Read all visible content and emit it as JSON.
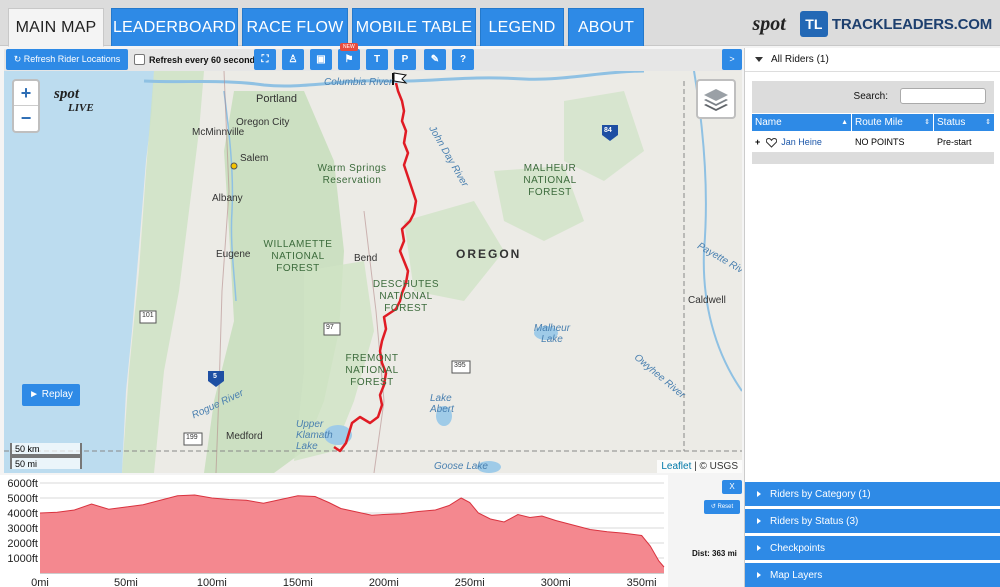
{
  "nav": {
    "tabs": [
      {
        "label": "MAIN MAP",
        "active": true
      },
      {
        "label": "LEADERBOARD",
        "active": false
      },
      {
        "label": "RACE FLOW",
        "active": false
      },
      {
        "label": "MOBILE TABLE",
        "active": false
      },
      {
        "label": "LEGEND",
        "active": false
      },
      {
        "label": "ABOUT",
        "active": false
      }
    ],
    "spot_logo": "spot",
    "tl_logo": "TL",
    "tl_name": "TRACKLEADERS.COM"
  },
  "toolbar": {
    "refresh_label": "Refresh Rider Locations",
    "auto_refresh_label": "Refresh every 60 seconds",
    "auto_refresh_checked": false,
    "icon_buttons": [
      {
        "name": "fullscreen-icon",
        "glyph": "⛶"
      },
      {
        "name": "person-icon",
        "glyph": "♙"
      },
      {
        "name": "image-icon",
        "glyph": "▣"
      },
      {
        "name": "flag-icon",
        "glyph": "⚑"
      },
      {
        "name": "t-button",
        "glyph": "T"
      },
      {
        "name": "p-button",
        "glyph": "P"
      },
      {
        "name": "link-icon",
        "glyph": "✎"
      },
      {
        "name": "help-icon",
        "glyph": "?"
      }
    ],
    "new_badge": "NEW",
    "expand_glyph": ">"
  },
  "map": {
    "zoom_in": "+",
    "zoom_out": "−",
    "spot_live_top": "spot",
    "spot_live_bottom": "LIVE",
    "replay_label": "► Replay",
    "scale_km": "50 km",
    "scale_mi": "50 mi",
    "attrib_leaflet": "Leaflet",
    "attrib_rest": " | © USGS",
    "labels": {
      "portland": "Portland",
      "columbia_river": "Columbia River",
      "oregon_city": "Oregon City",
      "mcminnville": "McMinnville",
      "salem": "Salem",
      "albany": "Albany",
      "eugene": "Eugene",
      "bend": "Bend",
      "medford": "Medford",
      "caldwell": "Caldwell",
      "lake_abert": "Lake Abert",
      "malheur_lake": "Malheur Lake",
      "goose_lake": "Goose Lake",
      "upper_klamath": "Upper Klamath Lake",
      "rogue_river": "Rogue River",
      "john_day_river": "John Day River",
      "owyhee_river": "Owyhee River",
      "payette_river": "Payette River",
      "warm_springs": "Warm Springs Reservation",
      "oregon": "OREGON",
      "willamette": "WILLAMETTE NATIONAL FOREST",
      "deschutes": "DESCHUTES NATIONAL FOREST",
      "fremont": "FREMONT NATIONAL FOREST",
      "malheur_nf": "MALHEUR NATIONAL FOREST"
    },
    "route_color": "#e01b24",
    "shields": {
      "i84": "84",
      "i5": "5",
      "r97": "97",
      "r395": "395",
      "r101": "101",
      "r199": "199"
    }
  },
  "panel": {
    "all_riders": "All Riders (1)",
    "search_label": "Search:",
    "search_value": "",
    "columns": [
      "Name",
      "Route Mile",
      "Status"
    ],
    "riders": [
      {
        "name": "Jan Heine",
        "route_mile": "NO POINTS",
        "status": "Pre-start"
      }
    ],
    "accordions": [
      "Riders by Category (1)",
      "Riders by Status (3)",
      "Checkpoints",
      "Map Layers"
    ]
  },
  "elevation": {
    "close_label": "X",
    "reset_label": "↺ Reset",
    "dist_label": "Dist: 363 mi",
    "fill_color": "#f4888f",
    "line_color": "#d9333f",
    "y_ticks": [
      "6000ft",
      "5000ft",
      "4000ft",
      "3000ft",
      "2000ft",
      "1000ft"
    ],
    "y_tick_values": [
      6000,
      5000,
      4000,
      3000,
      2000,
      1000
    ],
    "x_ticks": [
      "0mi",
      "50mi",
      "100mi",
      "150mi",
      "200mi",
      "250mi",
      "300mi",
      "350mi"
    ],
    "x_tick_values": [
      0,
      50,
      100,
      150,
      200,
      250,
      300,
      350
    ],
    "x_max": 363,
    "y_max": 6000,
    "profile": [
      [
        0,
        4000
      ],
      [
        10,
        4050
      ],
      [
        20,
        4200
      ],
      [
        30,
        4600
      ],
      [
        40,
        4250
      ],
      [
        50,
        4400
      ],
      [
        60,
        4550
      ],
      [
        70,
        4850
      ],
      [
        80,
        5150
      ],
      [
        90,
        5200
      ],
      [
        100,
        5000
      ],
      [
        110,
        4900
      ],
      [
        120,
        4850
      ],
      [
        130,
        4650
      ],
      [
        140,
        4900
      ],
      [
        150,
        5150
      ],
      [
        160,
        5100
      ],
      [
        168,
        4700
      ],
      [
        175,
        4300
      ],
      [
        185,
        4050
      ],
      [
        193,
        3850
      ],
      [
        200,
        3900
      ],
      [
        210,
        3950
      ],
      [
        220,
        4100
      ],
      [
        230,
        4200
      ],
      [
        238,
        4500
      ],
      [
        245,
        5000
      ],
      [
        250,
        4700
      ],
      [
        255,
        4000
      ],
      [
        262,
        3600
      ],
      [
        270,
        3400
      ],
      [
        278,
        3900
      ],
      [
        285,
        3700
      ],
      [
        292,
        3800
      ],
      [
        300,
        3500
      ],
      [
        310,
        3200
      ],
      [
        320,
        2900
      ],
      [
        330,
        2750
      ],
      [
        340,
        2650
      ],
      [
        350,
        2500
      ],
      [
        355,
        1800
      ],
      [
        360,
        800
      ],
      [
        363,
        400
      ]
    ]
  }
}
